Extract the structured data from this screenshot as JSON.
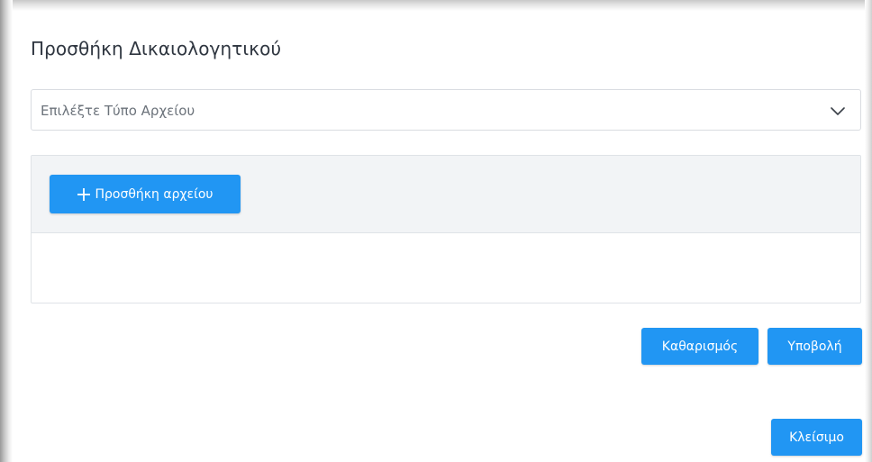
{
  "modal": {
    "title": "Προσθήκη Δικαιολογητικού"
  },
  "file_type_select": {
    "placeholder": "Επιλέξτε Τύπο Αρχείου",
    "icon": "chevron-down-icon"
  },
  "upload_panel": {
    "add_file_label": "Προσθήκη αρχείου",
    "add_icon": "plus-icon",
    "files": []
  },
  "actions": {
    "clear_label": "Καθαρισμός",
    "submit_label": "Υποβολή"
  },
  "footer": {
    "close_label": "Κλείσιμο"
  },
  "colors": {
    "accent": "#2196f3",
    "title_text": "#2f3640",
    "placeholder_text": "#6c737b",
    "panel_header_bg": "#f2f4f6"
  }
}
